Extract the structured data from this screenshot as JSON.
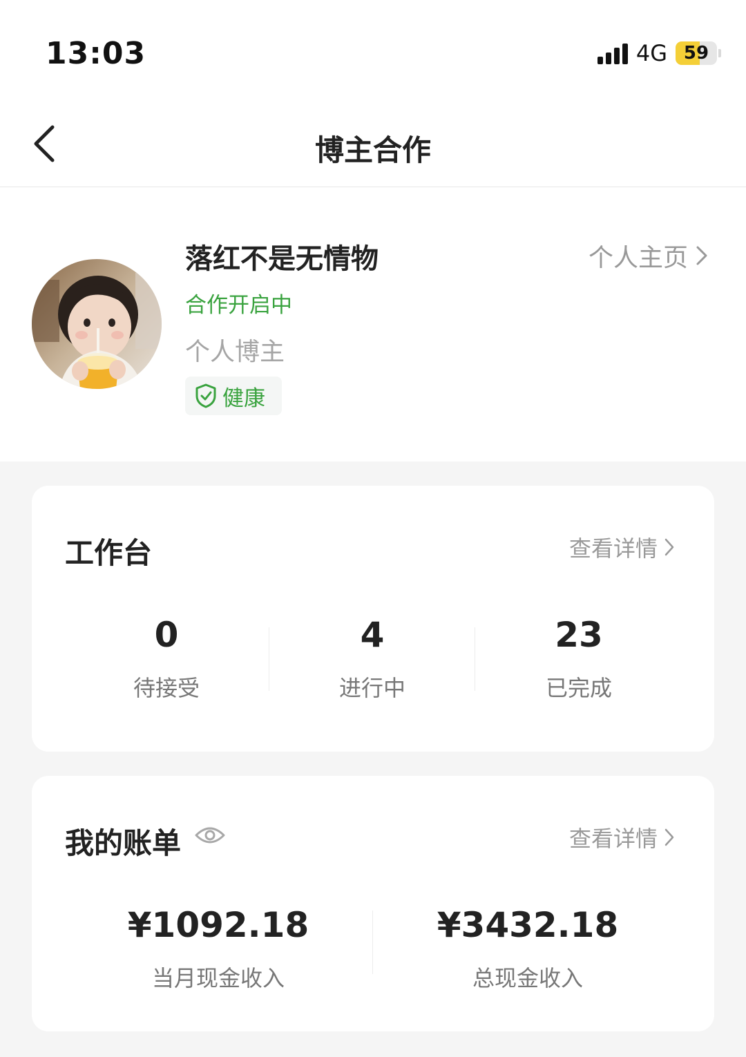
{
  "status_bar": {
    "time": "13:03",
    "network": "4G",
    "battery": "59",
    "battery_level": 0.59
  },
  "nav": {
    "title": "博主合作",
    "back_icon": "chevron-left-icon"
  },
  "profile": {
    "name": "落红不是无情物",
    "cooperation_status": "合作开启中",
    "account_type": "个人博主",
    "health_label": "健康",
    "homepage_link": "个人主页",
    "status_color": "#3aa33f"
  },
  "workbench": {
    "title": "工作台",
    "detail_link": "查看详情",
    "stats": [
      {
        "value": "0",
        "label": "待接受"
      },
      {
        "value": "4",
        "label": "进行中"
      },
      {
        "value": "23",
        "label": "已完成"
      }
    ]
  },
  "bill": {
    "title": "我的账单",
    "detail_link": "查看详情",
    "items": [
      {
        "value": "¥1092.18",
        "label": "当月现金收入"
      },
      {
        "value": "¥3432.18",
        "label": "总现金收入"
      }
    ]
  }
}
